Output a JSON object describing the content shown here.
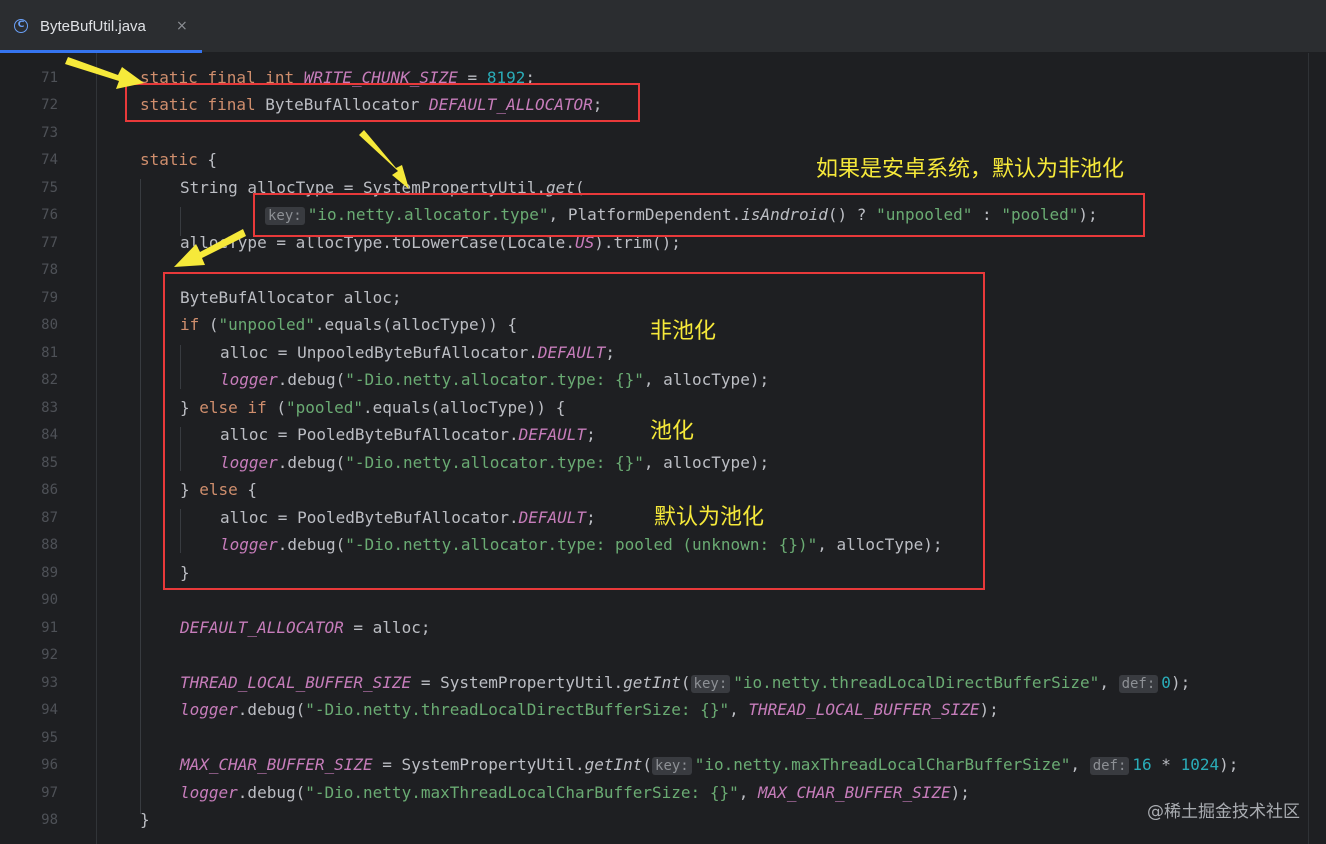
{
  "tab": {
    "icon": "class-icon",
    "icon_glyph": "C",
    "filename": "ByteBufUtil.java",
    "close_glyph": "×"
  },
  "line_numbers": [
    "71",
    "72",
    "73",
    "74",
    "75",
    "76",
    "77",
    "78",
    "79",
    "80",
    "81",
    "82",
    "83",
    "84",
    "85",
    "86",
    "87",
    "88",
    "89",
    "90",
    "91",
    "92",
    "93",
    "94",
    "95",
    "96",
    "97",
    "98"
  ],
  "code": {
    "l71": {
      "t1": "static",
      "t2": "final",
      "t3": "int",
      "c1": "WRITE_CHUNK_SIZE",
      "p1": " = ",
      "n1": "8192",
      "p2": ";"
    },
    "l72": {
      "t1": "static",
      "t2": "final",
      "p1": " ByteBufAllocator ",
      "c1": "DEFAULT_ALLOCATOR",
      "p2": ";"
    },
    "l74": {
      "t1": "static",
      "p1": " {"
    },
    "l75": {
      "p1": "String allocType = SystemPropertyUtil.",
      "m1": "get",
      "p2": "("
    },
    "l76": {
      "h1": "key:",
      "s1": "\"io.netty.allocator.type\"",
      "p1": ", PlatformDependent.",
      "m1": "isAndroid",
      "p2": "() ? ",
      "s2": "\"unpooled\"",
      "p3": " : ",
      "s3": "\"pooled\"",
      "p4": ");"
    },
    "l77": {
      "p1": "allocType = allocType.toLowerCase(Locale.",
      "c1": "US",
      "p2": ").trim();"
    },
    "l79": {
      "p1": "ByteBufAllocator alloc;"
    },
    "l80": {
      "t1": "if",
      "p1": " (",
      "s1": "\"unpooled\"",
      "p2": ".equals(allocType)) {"
    },
    "l81": {
      "p1": "alloc = UnpooledByteBufAllocator.",
      "c1": "DEFAULT",
      "p2": ";"
    },
    "l82": {
      "c1": "logger",
      "p1": ".debug(",
      "s1": "\"-Dio.netty.allocator.type: {}\"",
      "p2": ", allocType);"
    },
    "l83": {
      "p1": "} ",
      "t1": "else",
      "t2": "if",
      "p2": " (",
      "s1": "\"pooled\"",
      "p3": ".equals(allocType)) {"
    },
    "l84": {
      "p1": "alloc = PooledByteBufAllocator.",
      "c1": "DEFAULT",
      "p2": ";"
    },
    "l85": {
      "c1": "logger",
      "p1": ".debug(",
      "s1": "\"-Dio.netty.allocator.type: {}\"",
      "p2": ", allocType);"
    },
    "l86": {
      "p1": "} ",
      "t1": "else",
      "p2": " {"
    },
    "l87": {
      "p1": "alloc = PooledByteBufAllocator.",
      "c1": "DEFAULT",
      "p2": ";"
    },
    "l88": {
      "c1": "logger",
      "p1": ".debug(",
      "s1": "\"-Dio.netty.allocator.type: pooled (unknown: {})\"",
      "p2": ", allocType);"
    },
    "l89": {
      "p1": "}"
    },
    "l91": {
      "c1": "DEFAULT_ALLOCATOR",
      "p1": " = alloc;"
    },
    "l93": {
      "c1": "THREAD_LOCAL_BUFFER_SIZE",
      "p1": " = SystemPropertyUtil.",
      "m1": "getInt",
      "p2": "(",
      "h1": "key:",
      "s1": "\"io.netty.threadLocalDirectBufferSize\"",
      "p3": ", ",
      "h2": "def:",
      "n1": "0",
      "p4": ");"
    },
    "l94": {
      "c1": "logger",
      "p1": ".debug(",
      "s1": "\"-Dio.netty.threadLocalDirectBufferSize: {}\"",
      "p2": ", ",
      "c2": "THREAD_LOCAL_BUFFER_SIZE",
      "p3": ");"
    },
    "l96": {
      "c1": "MAX_CHAR_BUFFER_SIZE",
      "p1": " = SystemPropertyUtil.",
      "m1": "getInt",
      "p2": "(",
      "h1": "key:",
      "s1": "\"io.netty.maxThreadLocalCharBufferSize\"",
      "p3": ", ",
      "h2": "def:",
      "n1": "16",
      "p4": " * ",
      "n2": "1024",
      "p5": ");"
    },
    "l97": {
      "c1": "logger",
      "p1": ".debug(",
      "s1": "\"-Dio.netty.maxThreadLocalCharBufferSize: {}\"",
      "p2": ", ",
      "c2": "MAX_CHAR_BUFFER_SIZE",
      "p3": ");"
    },
    "l98": {
      "p1": "}"
    }
  },
  "annotations": {
    "android_note": "如果是安卓系统，默认为非池化",
    "unpooled_note": "非池化",
    "pooled_note": "池化",
    "default_note": "默认为池化"
  },
  "watermark": "@稀土掘金技术社区",
  "colors": {
    "keyword": "#cf8e6d",
    "constant": "#c77dbb",
    "string": "#6aab73",
    "number": "#2aacb8",
    "annotation_text": "#f6e93a",
    "highlight_box": "#e8393a",
    "arrow": "#f6e93a",
    "tab_underline": "#3574f0"
  }
}
